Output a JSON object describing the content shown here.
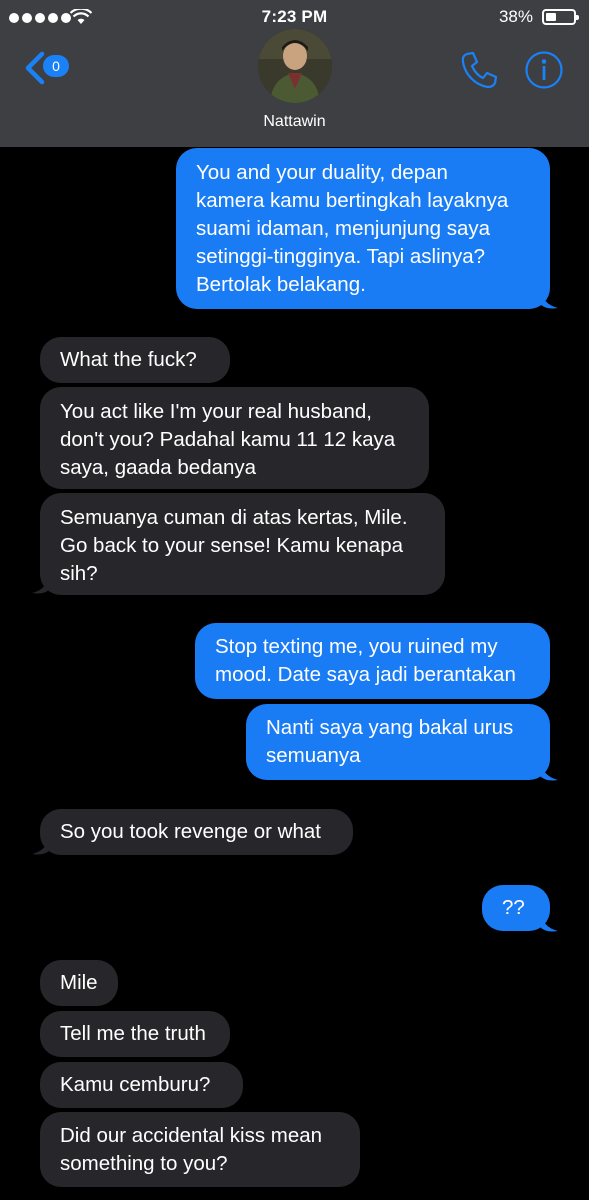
{
  "status_bar": {
    "time": "7:23 PM",
    "battery": "38%",
    "battery_level": 0.38
  },
  "header": {
    "back_count": "0",
    "contact_name": "Nattawin",
    "icons": [
      "back-chevron-icon",
      "phone-icon",
      "info-icon"
    ]
  },
  "colors": {
    "header_bg": "#3d3f43",
    "outgoing_bubble": "#1a7cf5",
    "incoming_bubble": "#27262b",
    "accent": "#1a82f6",
    "background": "#000000"
  },
  "messages": [
    {
      "direction": "outgoing",
      "text": "You and your duality, depan\nkamera kamu bertingkah layaknya\nsuami idaman, menjunjung saya\nsetinggi-tingginya. Tapi aslinya?\nBertolak belakang."
    },
    {
      "direction": "incoming",
      "text": "What the fuck?"
    },
    {
      "direction": "incoming",
      "text": "You act like I'm your real husband,\ndon't you? Padahal kamu 11 12 kaya\nsaya, gaada bedanya"
    },
    {
      "direction": "incoming",
      "text": "Semuanya cuman di atas kertas, Mile.\nGo back to your sense! Kamu kenapa\nsih?"
    },
    {
      "direction": "outgoing",
      "text": "Stop texting me, you ruined my\nmood. Date saya jadi berantakan"
    },
    {
      "direction": "outgoing",
      "text": "Nanti saya yang bakal urus\nsemuanya"
    },
    {
      "direction": "incoming",
      "text": "So you took revenge or what"
    },
    {
      "direction": "outgoing",
      "text": "??"
    },
    {
      "direction": "incoming",
      "text": "Mile"
    },
    {
      "direction": "incoming",
      "text": "Tell me the truth"
    },
    {
      "direction": "incoming",
      "text": "Kamu cemburu?"
    },
    {
      "direction": "incoming",
      "text": "Did our accidental kiss mean\nsomething to you?"
    }
  ]
}
